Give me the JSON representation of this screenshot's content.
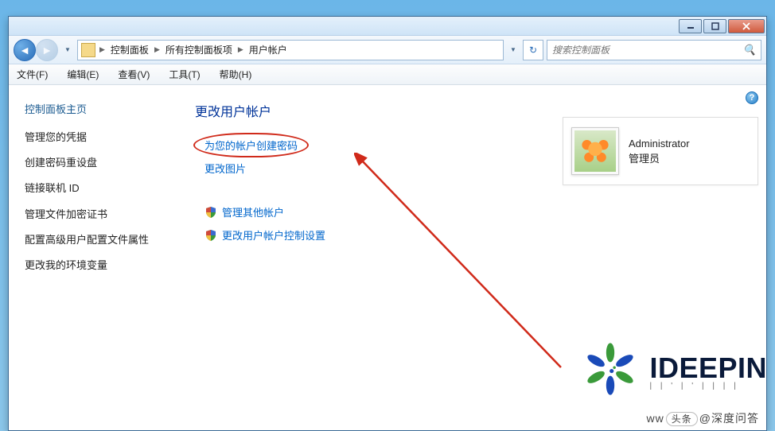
{
  "breadcrumb": {
    "items": [
      "控制面板",
      "所有控制面板项",
      "用户帐户"
    ]
  },
  "search": {
    "placeholder": "搜索控制面板"
  },
  "menu": {
    "file": "文件(F)",
    "edit": "编辑(E)",
    "view": "查看(V)",
    "tools": "工具(T)",
    "help": "帮助(H)"
  },
  "sidebar": {
    "header": "控制面板主页",
    "links": [
      "管理您的凭据",
      "创建密码重设盘",
      "链接联机 ID",
      "管理文件加密证书",
      "配置高级用户配置文件属性",
      "更改我的环境变量"
    ]
  },
  "main": {
    "heading": "更改用户帐户",
    "tasks": {
      "create_password": "为您的帐户创建密码",
      "change_picture": "更改图片",
      "manage_other": "管理其他帐户",
      "uac_settings": "更改用户帐户控制设置"
    }
  },
  "user": {
    "name": "Administrator",
    "role": "管理员"
  },
  "watermark": {
    "brand": "IDEEPIN",
    "site_prefix": "ww",
    "tag": "头条",
    "author": "@深度问答"
  }
}
